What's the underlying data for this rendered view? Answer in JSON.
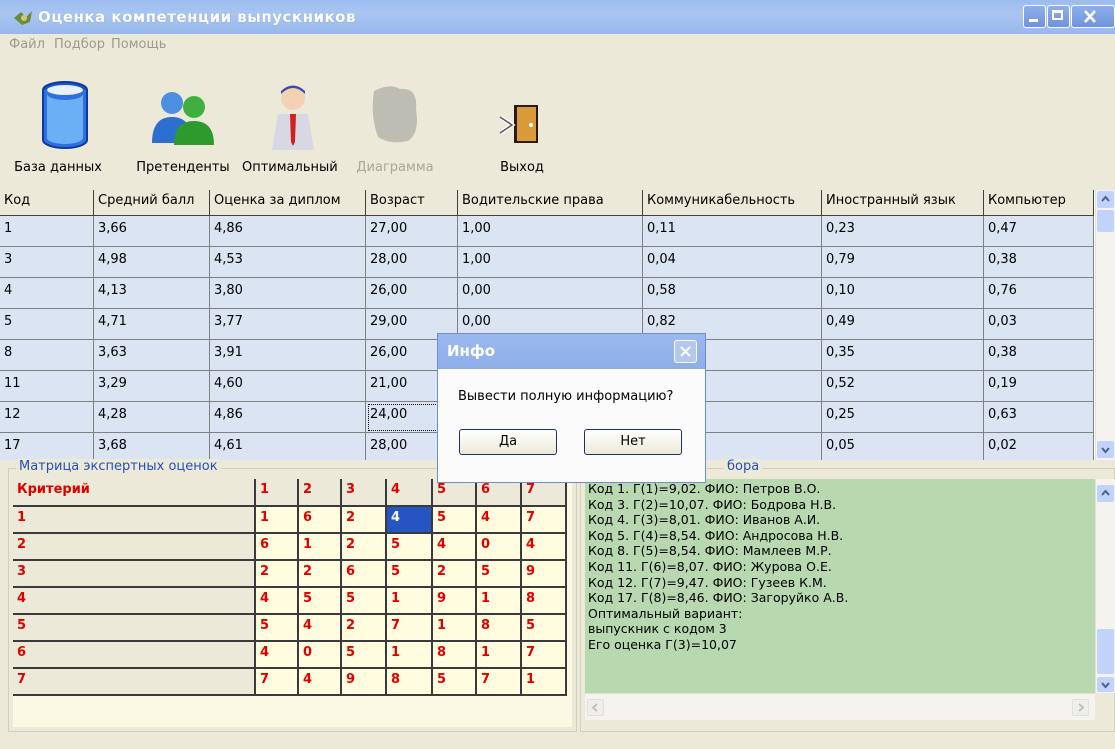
{
  "window": {
    "title": "Оценка компетенции выпускников"
  },
  "menu": [
    "Файл",
    "Подбор",
    "Помощь"
  ],
  "toolbar": {
    "buttons": [
      {
        "label": "База данных",
        "icon": "database-icon",
        "enabled": true
      },
      {
        "label": "Претенденты",
        "icon": "users-icon",
        "enabled": true
      },
      {
        "label": "Оптимальный",
        "icon": "person-icon",
        "enabled": true
      },
      {
        "label": "Диаграмма",
        "icon": "chart-icon",
        "enabled": false
      },
      {
        "label": "Выход",
        "icon": "exit-door-icon",
        "enabled": true
      }
    ]
  },
  "grid": {
    "columns": [
      "Код",
      "Средний балл",
      "Оценка за диплом",
      "Возраст",
      "Водительские права",
      "Коммуникабельность",
      "Иностранный язык",
      "Компьютер"
    ],
    "rows": [
      [
        "1",
        "3,66",
        "4,86",
        "27,00",
        "1,00",
        "0,11",
        "0,23",
        "0,47"
      ],
      [
        "3",
        "4,98",
        "4,53",
        "28,00",
        "1,00",
        "0,04",
        "0,79",
        "0,38"
      ],
      [
        "4",
        "4,13",
        "3,80",
        "26,00",
        "0,00",
        "0,58",
        "0,10",
        "0,76"
      ],
      [
        "5",
        "4,71",
        "3,77",
        "29,00",
        "0,00",
        "0,82",
        "0,49",
        "0,03"
      ],
      [
        "8",
        "3,63",
        "3,91",
        "26,00",
        "",
        "",
        "0,35",
        "0,38"
      ],
      [
        "11",
        "3,29",
        "4,60",
        "21,00",
        "",
        "",
        "0,52",
        "0,19"
      ],
      [
        "12",
        "4,28",
        "4,86",
        "24,00",
        "",
        "",
        "0,25",
        "0,63"
      ],
      [
        "17",
        "3,68",
        "4,61",
        "28,00",
        "",
        "",
        "0,05",
        "0,02"
      ]
    ]
  },
  "matrix": {
    "label": "Матрица экспертных оценок",
    "header": [
      "Критерий",
      "1",
      "2",
      "3",
      "4",
      "5",
      "6",
      "7"
    ],
    "rows": [
      [
        "1",
        "1",
        "6",
        "2",
        "4",
        "5",
        "4",
        "7"
      ],
      [
        "2",
        "6",
        "1",
        "2",
        "5",
        "4",
        "0",
        "4"
      ],
      [
        "3",
        "2",
        "2",
        "6",
        "5",
        "2",
        "5",
        "9"
      ],
      [
        "4",
        "4",
        "5",
        "5",
        "1",
        "9",
        "1",
        "8"
      ],
      [
        "5",
        "5",
        "4",
        "2",
        "7",
        "1",
        "8",
        "5"
      ],
      [
        "6",
        "4",
        "0",
        "5",
        "1",
        "8",
        "1",
        "7"
      ],
      [
        "7",
        "7",
        "4",
        "9",
        "8",
        "5",
        "7",
        "1"
      ]
    ]
  },
  "results": {
    "label_fragment": "бора",
    "lines": [
      "Код 1. Г(1)=9,02. ФИО: Петров В.О.",
      "Код 3. Г(2)=10,07. ФИО: Бодрова Н.В.",
      "Код 4. Г(3)=8,01. ФИО: Иванов А.И.",
      "Код 5. Г(4)=8,54. ФИО: Андросова Н.В.",
      "Код 8. Г(5)=8,54. ФИО: Мамлеев М.Р.",
      "Код 11. Г(6)=8,07. ФИО: Журова О.Е.",
      "Код 12. Г(7)=9,47. ФИО: Гузеев К.М.",
      "Код 17. Г(8)=8,46. ФИО: Загоруйко А.В.",
      "Оптимальный вариант:",
      "выпускник с кодом 3",
      "Его оценка Г(3)=10,07"
    ]
  },
  "dialog": {
    "title": "Инфо",
    "message": "Вывести полную информацию?",
    "yes": "Да",
    "no": "Нет"
  }
}
